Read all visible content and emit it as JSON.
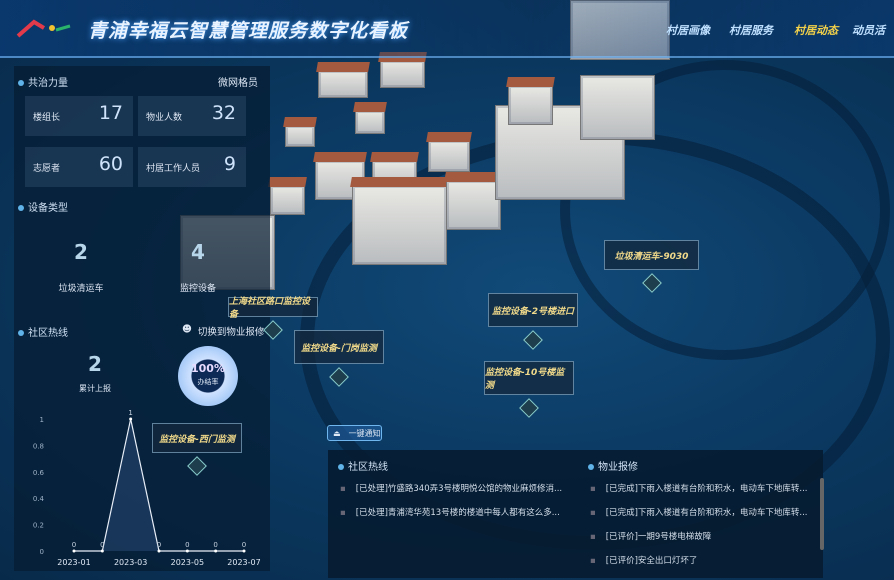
{
  "header": {
    "title": "青浦幸福云智慧管理服务数字化看板",
    "nav": [
      "村居画像",
      "村居服务",
      "村居动态",
      "动员活"
    ],
    "active_nav": 2
  },
  "gov": {
    "title": "共治力量",
    "subtitle": "微网格员",
    "stats": [
      {
        "label": "楼组长",
        "value": "17"
      },
      {
        "label": "物业人数",
        "value": "32"
      },
      {
        "label": "志愿者",
        "value": "60"
      },
      {
        "label": "村居工作人员",
        "value": "9"
      }
    ]
  },
  "devices": {
    "title": "设备类型",
    "items": [
      {
        "label": "垃圾清运车",
        "value": "2"
      },
      {
        "label": "监控设备",
        "value": "4"
      }
    ]
  },
  "hotline": {
    "title": "社区热线",
    "switch_label": "切换到物业报修",
    "total_label": "累计上报",
    "total": "2",
    "rate": "100%",
    "rate_label": "办结率"
  },
  "chart_data": {
    "type": "line",
    "x": [
      "2023-01",
      "2023-02",
      "2023-03",
      "2023-04",
      "2023-05",
      "2023-06",
      "2023-07"
    ],
    "values": [
      0,
      0,
      1,
      0,
      0,
      0,
      0
    ],
    "xticks": [
      "2023-01",
      "2023-03",
      "2023-05",
      "2023-07"
    ],
    "yticks": [
      "0",
      "0.2",
      "0.4",
      "0.6",
      "0.8",
      "1"
    ],
    "ylim": [
      0,
      1
    ],
    "title": "",
    "xlabel": "",
    "ylabel": ""
  },
  "map": {
    "tags": [
      "上海社区路口监控设备",
      "监控设备-门岗监测",
      "监控设备-2号楼进口",
      "监控设备-10号楼监测",
      "垃圾清运车-9030",
      "监控设备-西门监测"
    ]
  },
  "notify_button": "一键通知",
  "bottom": {
    "hotline_title": "社区热线",
    "hotline_items": [
      "[已处理]竹盛路340弄3号楼明悦公馆的物业麻烦修消...",
      "[已处理]青浦湾华苑13号楼的楼道中每人都有这么多..."
    ],
    "repair_title": "物业报修",
    "repair_items": [
      "[已完成]下雨入楼道有台阶和积水，电动车下地库转...",
      "[已完成]下雨入楼道有台阶和积水，电动车下地库转...",
      "[已评价]一期9号楼电梯故障",
      "[已评价]安全出口灯坏了"
    ]
  }
}
